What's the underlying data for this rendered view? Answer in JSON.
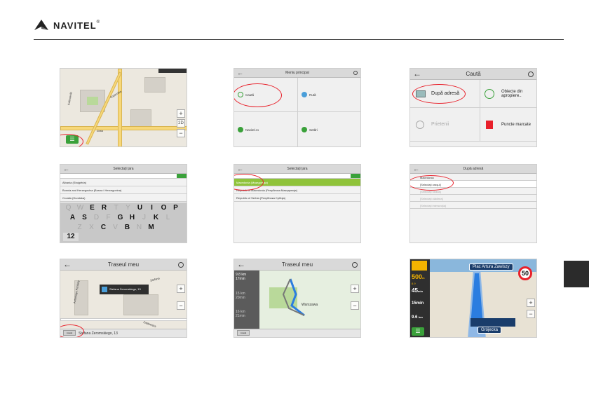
{
  "brand": {
    "name": "NAVITEL",
    "mark": "®"
  },
  "colors": {
    "accent_green": "#3aa13a",
    "highlight_red": "#e8202a",
    "selected_green": "#8fc33a"
  },
  "screen1": {
    "status": "",
    "streets": [
      "Kalinowski",
      "Kopernika",
      "Marszałkowska",
      "Bałtycka",
      "Złota"
    ],
    "zoom_label": "2D",
    "menu_icon": "menu-icon"
  },
  "screen2": {
    "title": "Meniu principal",
    "items": [
      "Caută",
      "Rută",
      "Navitel.ro",
      "Setări"
    ]
  },
  "screen3": {
    "title": "Caută",
    "items": [
      "După adresă",
      "Obiecte din apropiere..",
      "Prietenii",
      "Puncte marcate"
    ]
  },
  "screen4": {
    "title": "Selectați țara",
    "items": [
      "Albania (Shqipëria)",
      "Bosnia and Herzegovina (Bosna i Hercegovina)",
      "Croatia (Hrvatska)"
    ],
    "keyboard": {
      "row1": [
        "Q",
        "W",
        "E",
        "R",
        "T",
        "Y",
        "U",
        "I",
        "O",
        "P"
      ],
      "row1_active": [
        false,
        false,
        true,
        true,
        false,
        false,
        true,
        true,
        true,
        true
      ],
      "row2": [
        "A",
        "S",
        "D",
        "F",
        "G",
        "H",
        "J",
        "K",
        "L"
      ],
      "row2_active": [
        true,
        true,
        false,
        false,
        true,
        true,
        false,
        true,
        false
      ],
      "row3": [
        "Z",
        "X",
        "C",
        "V",
        "B",
        "N",
        "M"
      ],
      "row3_active": [
        false,
        false,
        true,
        false,
        true,
        false,
        true
      ],
      "numbers_key": "12"
    }
  },
  "screen5": {
    "title": "Selectați țara",
    "items": [
      "Macedonia (Македонија)",
      "Republic of Macedonia (Република Македонија)",
      "Republic of Serbia (Република Србија)"
    ]
  },
  "screen6": {
    "title": "După adresă",
    "items": [
      "Macedonia",
      "[Selectaţi oraşul]",
      "[Selectaţi strada]",
      "[Selectaţi clădirea]",
      "[Selectaţi intersecţia]"
    ]
  },
  "screen7": {
    "title": "Traseul meu",
    "popup": "Stefana Żeromskiego, 13",
    "address": "Stefana Żeromskiego, 13",
    "button": "Acasă",
    "streets": [
      "Stefana",
      "Skrzywa",
      "Zabławska",
      "Antoniego Fontany"
    ]
  },
  "screen8": {
    "title": "Traseul meu",
    "routes": [
      {
        "distance": "9.8",
        "unit": "km",
        "time": "17min"
      },
      {
        "distance": "15",
        "unit": "km",
        "time": "20min"
      },
      {
        "distance": "16",
        "unit": "km",
        "time": "21min"
      }
    ],
    "city": "Warszawa",
    "button": "Acasă"
  },
  "screen9": {
    "distance_turn": "500",
    "distance_turn_unit": "m",
    "remaining": "8.9",
    "time": "45",
    "time_unit": "min",
    "speed": "15min",
    "remaining_distance": "9.6",
    "remaining_unit": "km",
    "street_top": "Plac Artura Zawiszy",
    "street_bottom": "Grójecka",
    "speed_limit": "50"
  }
}
